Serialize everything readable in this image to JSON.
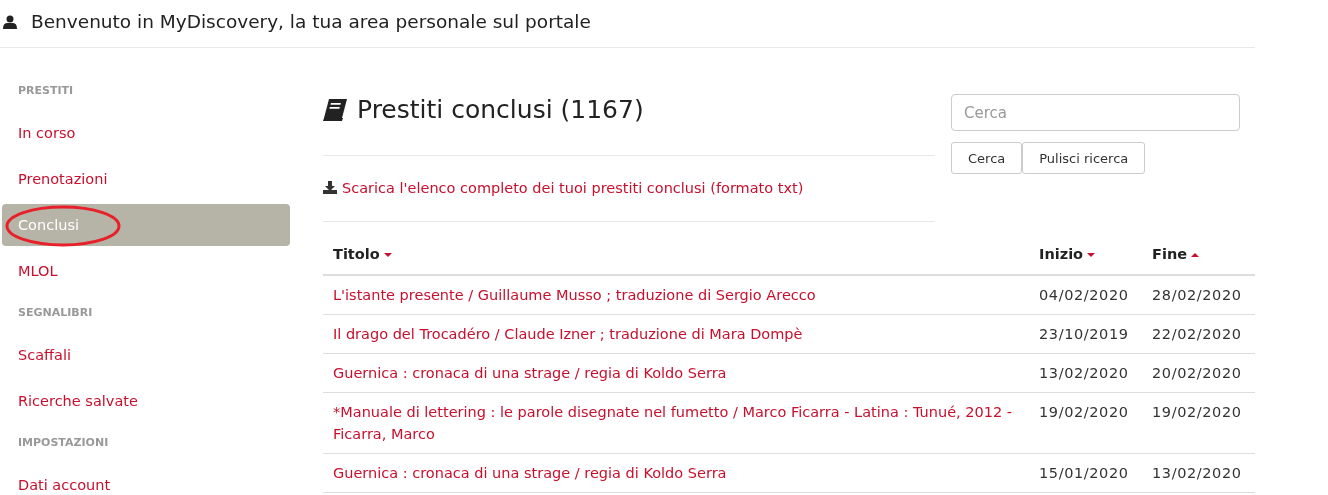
{
  "header": {
    "title": "Benvenuto in MyDiscovery, la tua area personale sul portale"
  },
  "sidebar": {
    "items": [
      {
        "kind": "heading",
        "label": "PRESTITI"
      },
      {
        "kind": "link",
        "label": "In corso",
        "selected": false,
        "circled": false
      },
      {
        "kind": "link",
        "label": "Prenotazioni",
        "selected": false,
        "circled": false
      },
      {
        "kind": "link",
        "label": "Conclusi",
        "selected": true,
        "circled": true
      },
      {
        "kind": "link",
        "label": "MLOL",
        "selected": false,
        "circled": false
      },
      {
        "kind": "heading",
        "label": "SEGNALIBRI"
      },
      {
        "kind": "link",
        "label": "Scaffali",
        "selected": false,
        "circled": false
      },
      {
        "kind": "link",
        "label": "Ricerche salvate",
        "selected": false,
        "circled": false
      },
      {
        "kind": "heading",
        "label": "IMPOSTAZIONI"
      },
      {
        "kind": "link",
        "label": "Dati account",
        "selected": false,
        "circled": false
      }
    ]
  },
  "main": {
    "title": "Prestiti conclusi (1167)",
    "download_link": "Scarica l'elenco completo dei tuoi prestiti conclusi (formato txt)"
  },
  "search": {
    "placeholder": "Cerca",
    "buttons": [
      "Cerca",
      "Pulisci ricerca"
    ]
  },
  "table": {
    "columns": [
      {
        "label": "Titolo",
        "sort_descending": true
      },
      {
        "label": "Inizio",
        "sort_descending": true
      },
      {
        "label": "Fine",
        "sort_descending": false
      }
    ],
    "rows": [
      [
        "L'istante presente / Guillaume Musso ; traduzione di Sergio Arecco",
        "04/02/2020",
        "28/02/2020"
      ],
      [
        "Il drago del Trocadéro / Claude Izner ; traduzione di Mara Dompè",
        "23/10/2019",
        "22/02/2020"
      ],
      [
        "Guernica : cronaca di una strage / regia di Koldo Serra",
        "13/02/2020",
        "20/02/2020"
      ],
      [
        "*Manuale di lettering : le parole disegnate nel fumetto / Marco Ficarra - Latina : Tunué, 2012 - Ficarra, Marco",
        "19/02/2020",
        "19/02/2020"
      ],
      [
        "Guernica : cronaca di una strage / regia di Koldo Serra",
        "15/01/2020",
        "13/02/2020"
      ]
    ]
  }
}
